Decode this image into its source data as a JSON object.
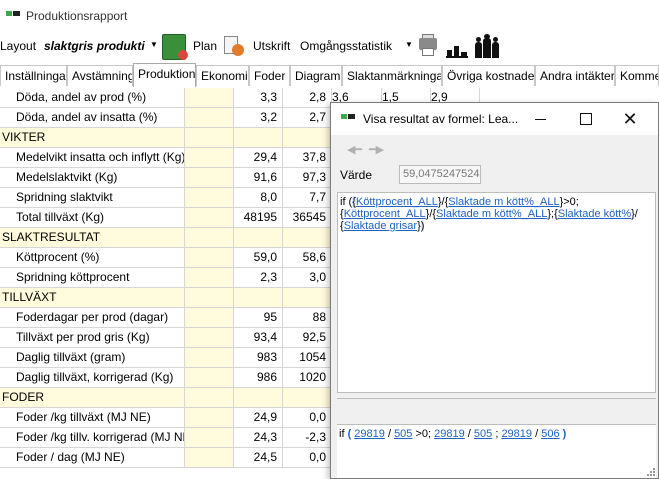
{
  "window": {
    "title": "Produktionsrapport"
  },
  "toolbar": {
    "layout_label": "Layout",
    "layout_value": "slaktgris produkti",
    "plan_label": "Plan",
    "print_label": "Utskrift",
    "stats_value": "Omgångsstatistik"
  },
  "tabs": [
    {
      "label": "Inställningar"
    },
    {
      "label": "Avstämning"
    },
    {
      "label": "Produktion"
    },
    {
      "label": "Ekonomi"
    },
    {
      "label": "Foder"
    },
    {
      "label": "Diagram"
    },
    {
      "label": "Slaktanmärkningar"
    },
    {
      "label": "Övriga kostnader"
    },
    {
      "label": "Andra intäkter"
    },
    {
      "label": "Kommen"
    }
  ],
  "grid": {
    "rows": [
      {
        "label": "Döda, andel av prod (%)",
        "v1": "3,3",
        "v2": "2,8",
        "v3": "3,6",
        "v4": "1,5",
        "v5": "2,9"
      },
      {
        "label": "Döda, andel av insatta (%)",
        "v1": "3,2",
        "v2": "2,7"
      },
      {
        "label": "VIKTER",
        "section": true
      },
      {
        "label": "Medelvikt insatta och inflytt (Kg)",
        "v1": "29,4",
        "v2": "37,8"
      },
      {
        "label": "Medelslaktvikt (Kg)",
        "v1": "91,6",
        "v2": "97,3"
      },
      {
        "label": "Spridning slaktvikt",
        "v1": "8,0",
        "v2": "7,7"
      },
      {
        "label": "Total tillväxt (Kg)",
        "v1": "48195",
        "v2": "36545"
      },
      {
        "label": "SLAKTRESULTAT",
        "section": true
      },
      {
        "label": "Köttprocent (%)",
        "v1": "59,0",
        "v2": "58,6"
      },
      {
        "label": "Spridning köttprocent",
        "v1": "2,3",
        "v2": "3,0"
      },
      {
        "label": "TILLVÄXT",
        "section": true
      },
      {
        "label": "Foderdagar per prod (dagar)",
        "v1": "95",
        "v2": "88"
      },
      {
        "label": "Tillväxt per prod gris (Kg)",
        "v1": "93,4",
        "v2": "92,5"
      },
      {
        "label": "Daglig tillväxt (gram)",
        "v1": "983",
        "v2": "1054"
      },
      {
        "label": "Daglig tillväxt, korrigerad (Kg)",
        "v1": "986",
        "v2": "1020"
      },
      {
        "label": "FODER",
        "section": true
      },
      {
        "label": "Foder /kg tillväxt (MJ NE)",
        "v1": "24,9",
        "v2": "0,0"
      },
      {
        "label": "Foder /kg tillv. korrigerad (MJ NE)",
        "v1": "24,3",
        "v2": "-2,3"
      },
      {
        "label": "Foder / dag (MJ NE)",
        "v1": "24,5",
        "v2": "0,0"
      }
    ]
  },
  "dialog": {
    "title": "Visa resultat av formel: Lea...",
    "value_label": "Värde",
    "value": "59,0475247524",
    "formula": {
      "if": "if",
      "t1": "Köttprocent_ALL",
      "t2": "Slaktade m kött%_ALL",
      "t3": "Köttprocent_ALL",
      "t4": "Slaktade m kött%_ALL",
      "t5": "Slaktade kött%",
      "t6": "Slaktade grisar"
    },
    "result": {
      "if": "if",
      "n1": "29819",
      "n2": "505",
      "n3": "29819",
      "n4": "505",
      "n5": "29819",
      "n6": "506"
    }
  }
}
